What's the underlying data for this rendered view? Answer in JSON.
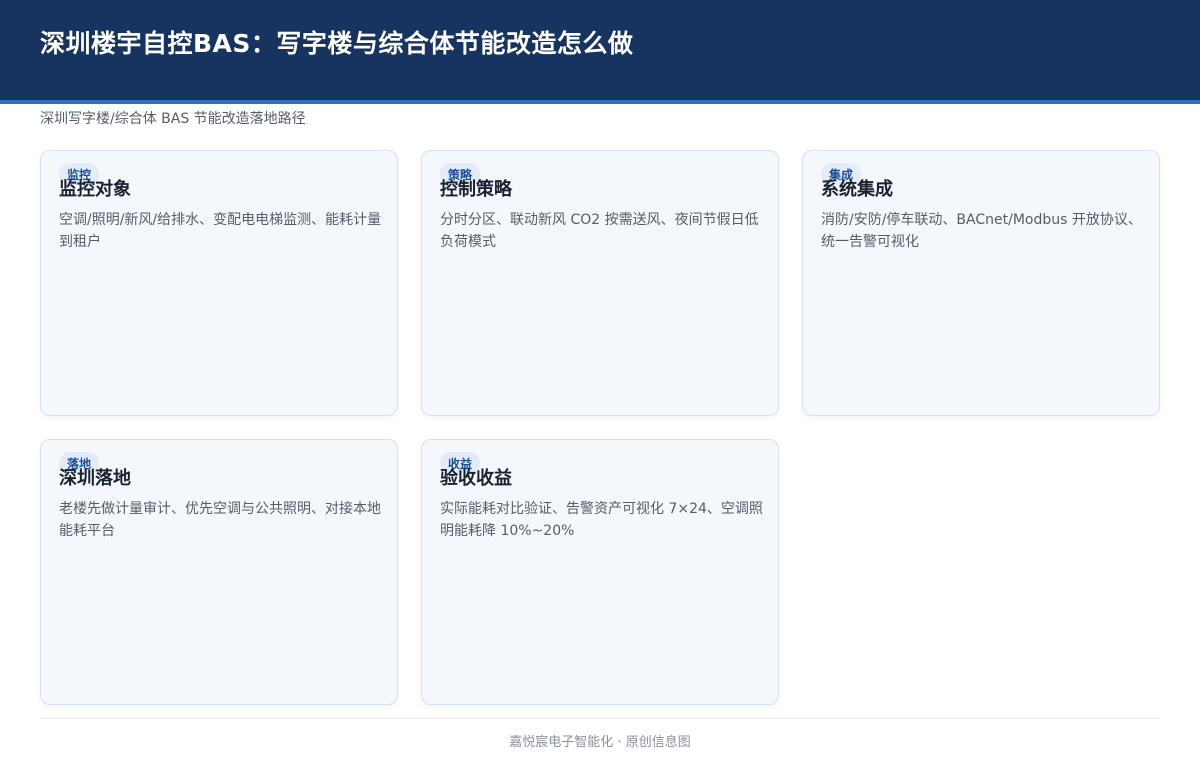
{
  "header": {
    "title": "深圳楼宇自控BAS：写字楼与综合体节能改造怎么做"
  },
  "subtitle": "深圳写字楼/综合体 BAS 节能改造落地路径",
  "cards": [
    {
      "badge": "监控",
      "title": "监控对象",
      "desc": "空调/照明/新风/给排水、变配电电梯监测、能耗计量到租户"
    },
    {
      "badge": "策略",
      "title": "控制策略",
      "desc": "分时分区、联动新风 CO2 按需送风、夜间节假日低负荷模式"
    },
    {
      "badge": "集成",
      "title": "系统集成",
      "desc": "消防/安防/停车联动、BACnet/Modbus 开放协议、统一告警可视化"
    },
    {
      "badge": "落地",
      "title": "深圳落地",
      "desc": "老楼先做计量审计、优先空调与公共照明、对接本地能耗平台"
    },
    {
      "badge": "收益",
      "title": "验收收益",
      "desc": "实际能耗对比验证、告警资产可视化 7×24、空调照明能耗降 10%~20%"
    }
  ],
  "footer": "嘉悦宸电子智能化 · 原创信息图"
}
